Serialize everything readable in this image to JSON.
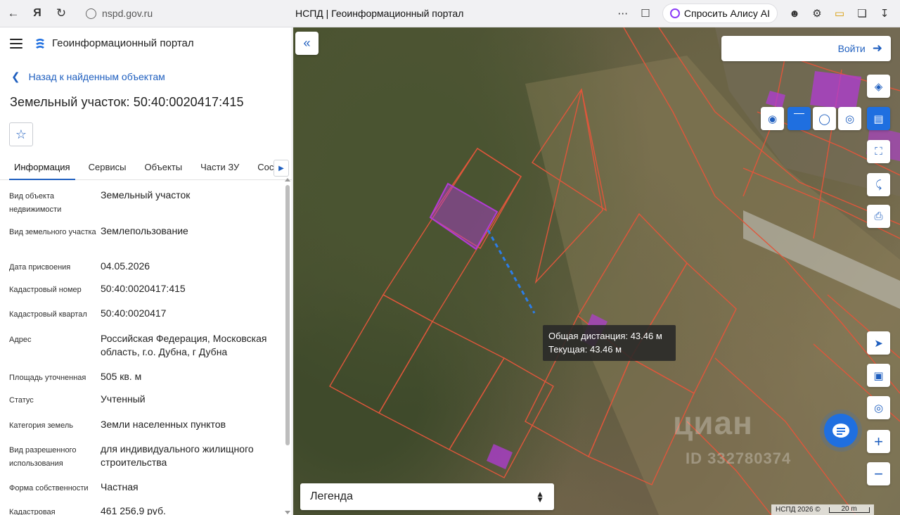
{
  "browser": {
    "url": "nspd.gov.ru",
    "page_title": "НСПД | Геоинформационный портал",
    "alice_label": "Спросить Алису AI"
  },
  "panel": {
    "app_name": "Геоинформационный портал",
    "back_link": "Назад к найденным объектам",
    "object_title": "Земельный участок: 50:40:0020417:415",
    "tabs": [
      "Информация",
      "Сервисы",
      "Объекты",
      "Части ЗУ",
      "Состав"
    ],
    "active_tab": "Информация",
    "properties": [
      {
        "key": "Вид объекта недвижимости",
        "value": "Земельный участок"
      },
      {
        "key": "Вид земельного участка",
        "value": "Землепользование"
      },
      {
        "key": "Дата присвоения",
        "value": "04.05.2026"
      },
      {
        "key": "Кадастровый номер",
        "value": "50:40:0020417:415"
      },
      {
        "key": "Кадастровый квартал",
        "value": "50:40:0020417"
      },
      {
        "key": "Адрес",
        "value": "Российская Федерация, Московская область, г.о. Дубна, г Дубна"
      },
      {
        "key": "Площадь уточненная",
        "value": "505 кв. м"
      },
      {
        "key": "Статус",
        "value": "Учтенный"
      },
      {
        "key": "Категория земель",
        "value": "Земли населенных пунктов"
      },
      {
        "key": "Вид разрешенного использования",
        "value": "для индивидуального жилищного строительства"
      },
      {
        "key": "Форма собственности",
        "value": "Частная"
      },
      {
        "key": "Кадастровая",
        "value": "461 256,9 руб."
      }
    ]
  },
  "map": {
    "login_label": "Войти",
    "measure_total": "Общая дистанция: 43.46 м",
    "measure_current": "Текущая: 43.46 м",
    "legend_label": "Легенда",
    "attribution": "НСПД 2026 ©",
    "scale_label": "20 m",
    "watermark": "циан",
    "watermark_id": "ID 332780374",
    "colors": {
      "accent": "#1f6fe0",
      "parcel_border": "#e0563b",
      "parcel_fill": "#b23bd6"
    }
  }
}
